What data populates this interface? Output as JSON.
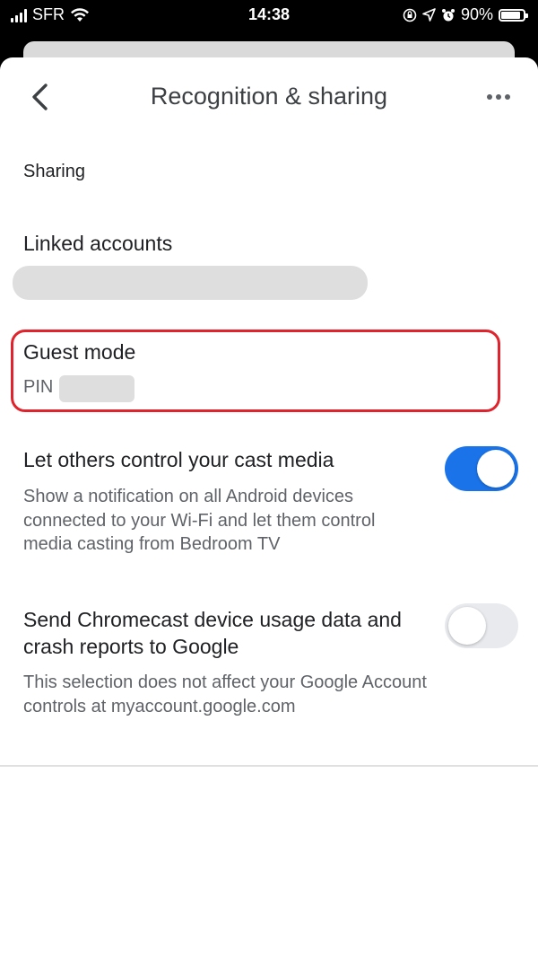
{
  "status_bar": {
    "carrier": "SFR",
    "time": "14:38",
    "battery_percent": "90%",
    "battery_level": 0.9,
    "icons": [
      "signal-icon",
      "wifi-icon",
      "orientation-lock-icon",
      "location-icon",
      "alarm-icon",
      "battery-icon"
    ]
  },
  "app_bar": {
    "title": "Recognition & sharing",
    "back_icon": "chevron-left-icon",
    "menu_icon": "more-horizontal-icon"
  },
  "sharing": {
    "section_header": "Sharing",
    "linked_accounts": {
      "title": "Linked accounts"
    },
    "guest_mode": {
      "title": "Guest mode",
      "pin_label": "PIN",
      "highlight_color": "#e0242e"
    },
    "cast_control": {
      "title": "Let others control your cast media",
      "description": "Show a notification on all Android devices connected to your Wi-Fi and let them control media casting from Bedroom  TV",
      "enabled": true,
      "toggle_color": "#1a73e8"
    },
    "usage_data": {
      "title": "Send Chromecast device usage data and crash reports to Google",
      "description": "This selection does not affect your Google Account controls at myaccount.google.com",
      "enabled": false
    }
  }
}
